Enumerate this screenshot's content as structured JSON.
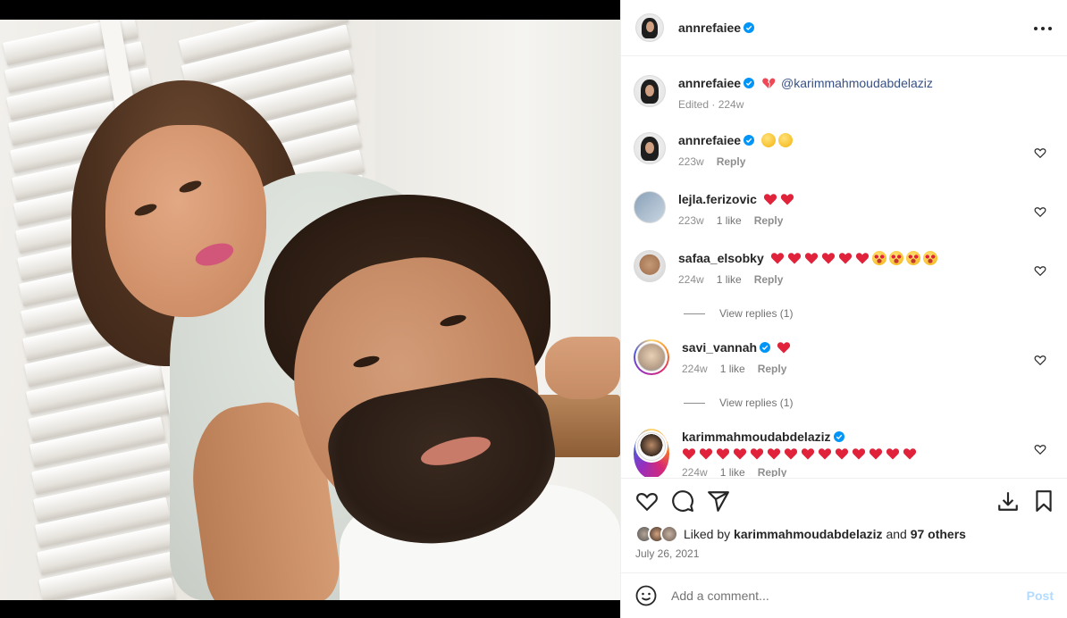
{
  "header": {
    "username": "annrefaiee"
  },
  "caption": {
    "username": "annrefaiee",
    "mention": "@karimmahmoudabdelaziz",
    "meta": "Edited · 224w"
  },
  "comments": [
    {
      "username": "annrefaiee",
      "time": "223w",
      "likes": "",
      "reply": "Reply"
    },
    {
      "username": "lejla.ferizovic",
      "time": "223w",
      "likes": "1 like",
      "reply": "Reply"
    },
    {
      "username": "safaa_elsobky",
      "time": "224w",
      "likes": "1 like",
      "reply": "Reply",
      "view_replies": "View replies (1)"
    },
    {
      "username": "savi_vannah",
      "time": "224w",
      "likes": "1 like",
      "reply": "Reply",
      "view_replies": "View replies (1)"
    },
    {
      "username": "karimmahmoudabdelaziz",
      "time": "224w",
      "likes": "1 like",
      "reply": "Reply"
    }
  ],
  "likes": {
    "prefix": "Liked by",
    "user": "karimmahmoudabdelaziz",
    "and": "and",
    "others": "97 others"
  },
  "date": "July 26, 2021",
  "add_comment": {
    "placeholder": "Add a comment...",
    "post_label": "Post"
  },
  "colors": {
    "verified": "#0095f6",
    "heart": "#ed4956",
    "mention": "#385185",
    "post_disabled": "#b3dbff"
  },
  "icons": [
    "more-icon",
    "heart-icon",
    "comment-icon",
    "share-icon",
    "save-icon",
    "bookmark-icon",
    "emoji-icon",
    "verified-icon"
  ]
}
